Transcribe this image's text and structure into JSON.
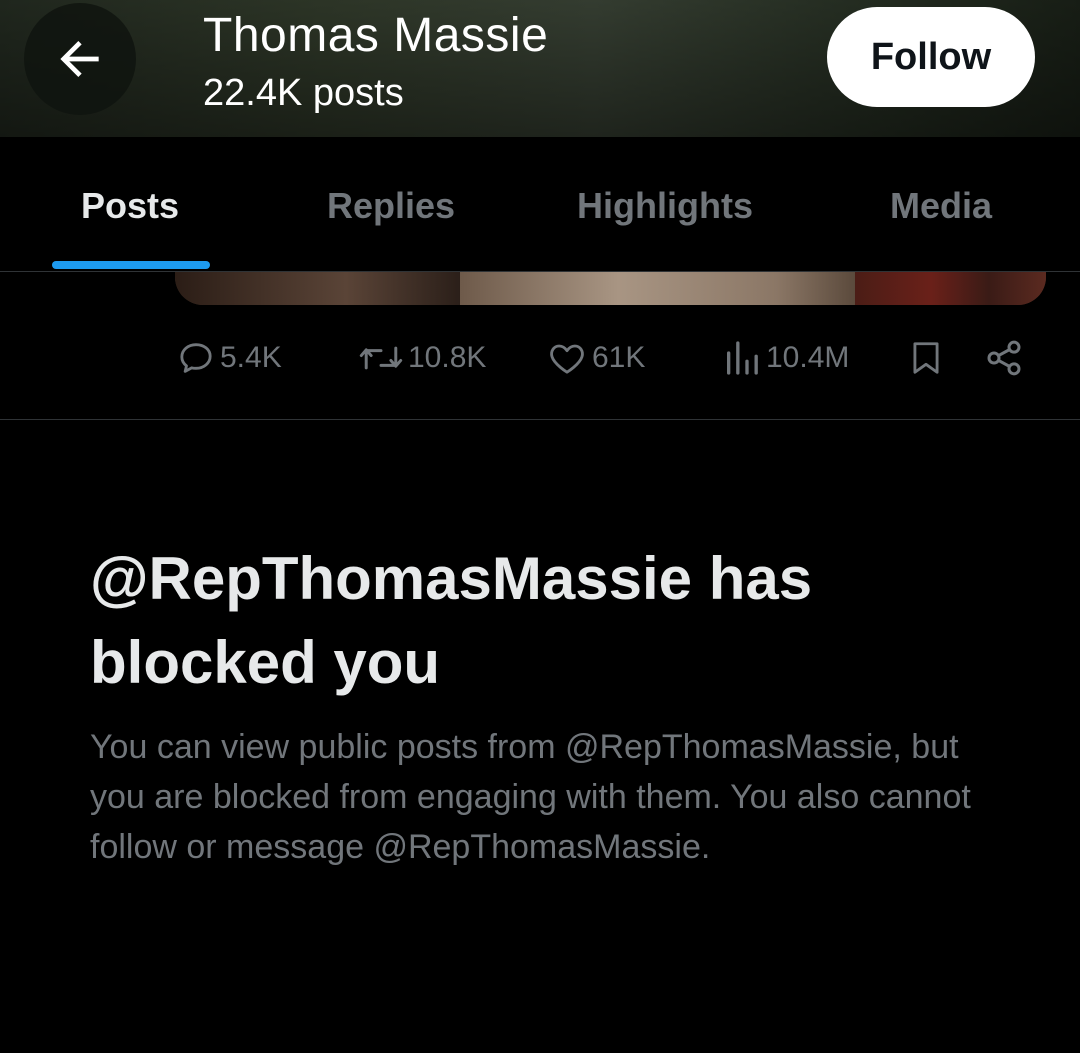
{
  "header": {
    "name": "Thomas Massie",
    "post_count": "22.4K posts",
    "follow_label": "Follow"
  },
  "icons": {
    "back": "back-arrow-icon",
    "reply": "reply-bubble-icon",
    "repost": "repost-icon",
    "like": "heart-icon",
    "views": "views-bar-chart-icon",
    "bookmark": "bookmark-icon",
    "share": "share-icon"
  },
  "tabs": [
    {
      "label": "Posts",
      "active": true
    },
    {
      "label": "Replies",
      "active": false
    },
    {
      "label": "Highlights",
      "active": false
    },
    {
      "label": "Media",
      "active": false
    }
  ],
  "post_actions": {
    "replies": "5.4K",
    "reposts": "10.8K",
    "likes": "61K",
    "views": "10.4M"
  },
  "blocked": {
    "title": "@RepThomasMassie has blocked you",
    "description": "You can view public posts from @RepThomasMassie, but you are blocked from engaging with them. You also cannot follow or message @RepThomasMassie."
  },
  "colors": {
    "background": "#000000",
    "accent": "#1d9bf0",
    "muted_text": "#71767b",
    "primary_text": "#e7e9ea"
  }
}
